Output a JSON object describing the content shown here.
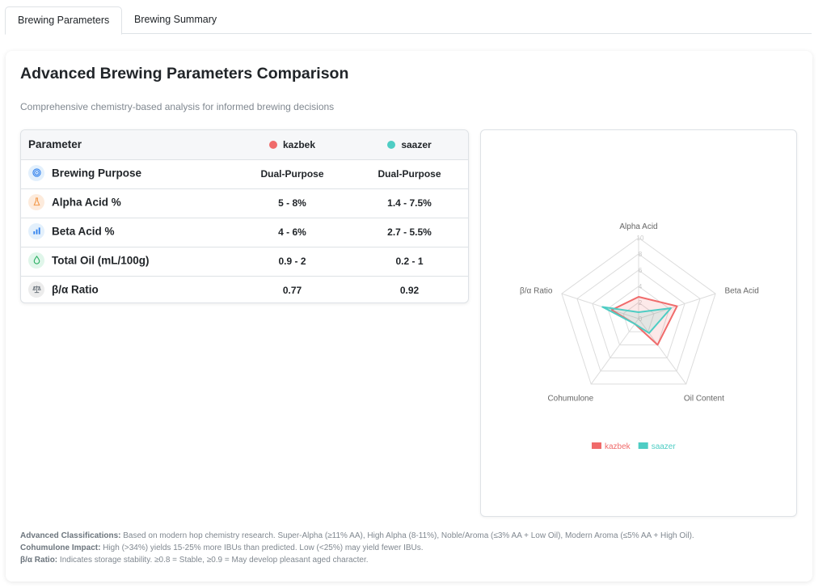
{
  "tabs": [
    {
      "label": "Brewing Parameters",
      "active": true
    },
    {
      "label": "Brewing Summary",
      "active": false
    }
  ],
  "header": {
    "title": "Advanced Brewing Parameters Comparison",
    "subtitle": "Comprehensive chemistry-based analysis for informed brewing decisions"
  },
  "table": {
    "param_header": "Parameter",
    "hops": [
      {
        "name": "kazbek",
        "color": "#f06b6b"
      },
      {
        "name": "saazer",
        "color": "#4ecdc4"
      }
    ],
    "rows": [
      {
        "label": "Brewing Purpose",
        "icon": "target-icon",
        "icon_bg": "#e3f0fc",
        "icon_color": "#2f80ed",
        "values": [
          "Dual-Purpose",
          "Dual-Purpose"
        ]
      },
      {
        "label": "Alpha Acid %",
        "icon": "flask-icon",
        "icon_bg": "#fdebdc",
        "icon_color": "#f2994a",
        "values": [
          "5 - 8%",
          "1.4 - 7.5%"
        ]
      },
      {
        "label": "Beta Acid %",
        "icon": "bar-chart-icon",
        "icon_bg": "#e3f0fc",
        "icon_color": "#2f80ed",
        "values": [
          "4 - 6%",
          "2.7 - 5.5%"
        ]
      },
      {
        "label": "Total Oil (mL/100g)",
        "icon": "droplet-icon",
        "icon_bg": "#e0f6ea",
        "icon_color": "#27ae60",
        "values": [
          "0.9 - 2",
          "0.2 - 1"
        ]
      },
      {
        "label": "β/α Ratio",
        "icon": "scale-icon",
        "icon_bg": "#ececec",
        "icon_color": "#6c757d",
        "values": [
          "0.77",
          "0.92"
        ]
      }
    ]
  },
  "chart_data": {
    "type": "radar",
    "axes": [
      "Alpha Acid",
      "Beta Acid",
      "Oil Content",
      "Cohumulone",
      "β/α Ratio"
    ],
    "rlim": [
      0,
      10
    ],
    "ticks": [
      "0",
      "2",
      "4",
      "6",
      "8",
      "10"
    ],
    "grid": true,
    "legend_position": "bottom",
    "series": [
      {
        "name": "kazbek",
        "color": "#f06b6b",
        "values": [
          2.7,
          5.0,
          4.0,
          0.8,
          3.5
        ]
      },
      {
        "name": "saazer",
        "color": "#4ecdc4",
        "values": [
          0.8,
          4.2,
          2.2,
          0.8,
          4.7
        ]
      }
    ]
  },
  "notes": [
    {
      "label": "Advanced Classifications:",
      "text": " Based on modern hop chemistry research. Super-Alpha (≥11% AA), High Alpha (8-11%), Noble/Aroma (≤3% AA + Low Oil), Modern Aroma (≤5% AA + High Oil)."
    },
    {
      "label": "Cohumulone Impact:",
      "text": " High (>34%) yields 15-25% more IBUs than predicted. Low (<25%) may yield fewer IBUs."
    },
    {
      "label": "β/α Ratio:",
      "text": " Indicates storage stability. ≥0.8 = Stable, ≥0.9 = May develop pleasant aged character."
    }
  ]
}
